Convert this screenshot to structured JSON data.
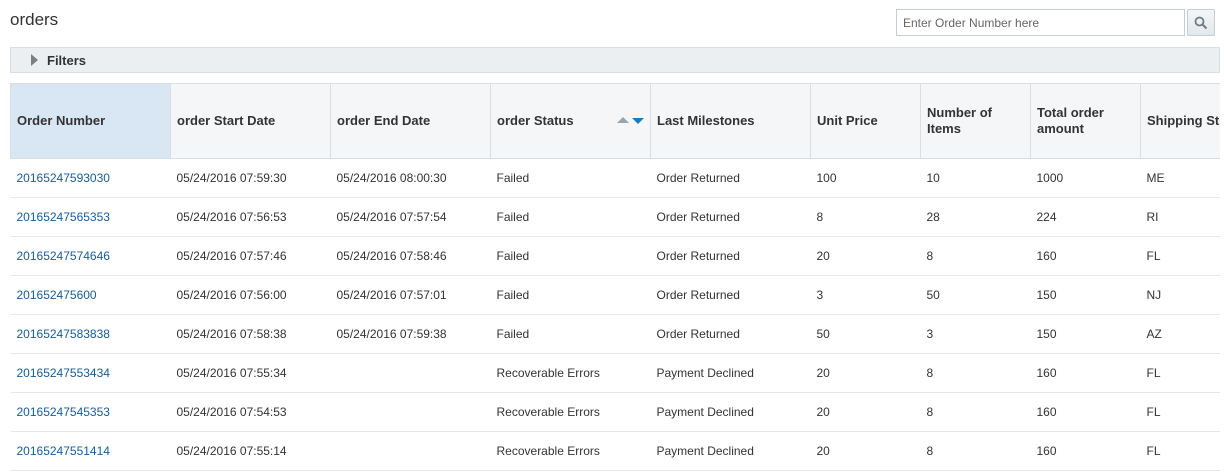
{
  "page": {
    "title": "orders"
  },
  "search": {
    "placeholder": "Enter Order Number here"
  },
  "filters": {
    "label": "Filters"
  },
  "table": {
    "columns": [
      "Order Number",
      "order Start Date",
      "order End Date",
      "order Status",
      "Last Milestones",
      "Unit Price",
      "Number of Items",
      "Total order amount",
      "Shipping St"
    ],
    "sort": {
      "column": "order Status",
      "direction": "descending"
    },
    "rows": [
      [
        "20165247593030",
        "05/24/2016 07:59:30",
        "05/24/2016 08:00:30",
        "Failed",
        "Order Returned",
        "100",
        "10",
        "1000",
        "ME"
      ],
      [
        "20165247565353",
        "05/24/2016 07:56:53",
        "05/24/2016 07:57:54",
        "Failed",
        "Order Returned",
        "8",
        "28",
        "224",
        "RI"
      ],
      [
        "20165247574646",
        "05/24/2016 07:57:46",
        "05/24/2016 07:58:46",
        "Failed",
        "Order Returned",
        "20",
        "8",
        "160",
        "FL"
      ],
      [
        "201652475600",
        "05/24/2016 07:56:00",
        "05/24/2016 07:57:01",
        "Failed",
        "Order Returned",
        "3",
        "50",
        "150",
        "NJ"
      ],
      [
        "20165247583838",
        "05/24/2016 07:58:38",
        "05/24/2016 07:59:38",
        "Failed",
        "Order Returned",
        "50",
        "3",
        "150",
        "AZ"
      ],
      [
        "20165247553434",
        "05/24/2016 07:55:34",
        "",
        "Recoverable Errors",
        "Payment Declined",
        "20",
        "8",
        "160",
        "FL"
      ],
      [
        "20165247545353",
        "05/24/2016 07:54:53",
        "",
        "Recoverable Errors",
        "Payment Declined",
        "20",
        "8",
        "160",
        "FL"
      ],
      [
        "20165247551414",
        "05/24/2016 07:55:14",
        "",
        "Recoverable Errors",
        "Payment Declined",
        "20",
        "8",
        "160",
        "FL"
      ]
    ]
  },
  "icons": {
    "search": "search-icon",
    "filters_toggle": "expand-triangle-icon",
    "sort_asc": "sort-ascending-icon",
    "sort_desc": "sort-descending-icon"
  },
  "colors": {
    "link": "#145c9e",
    "active_header": "#d9e6f3",
    "sort_active": "#0f7fce"
  }
}
